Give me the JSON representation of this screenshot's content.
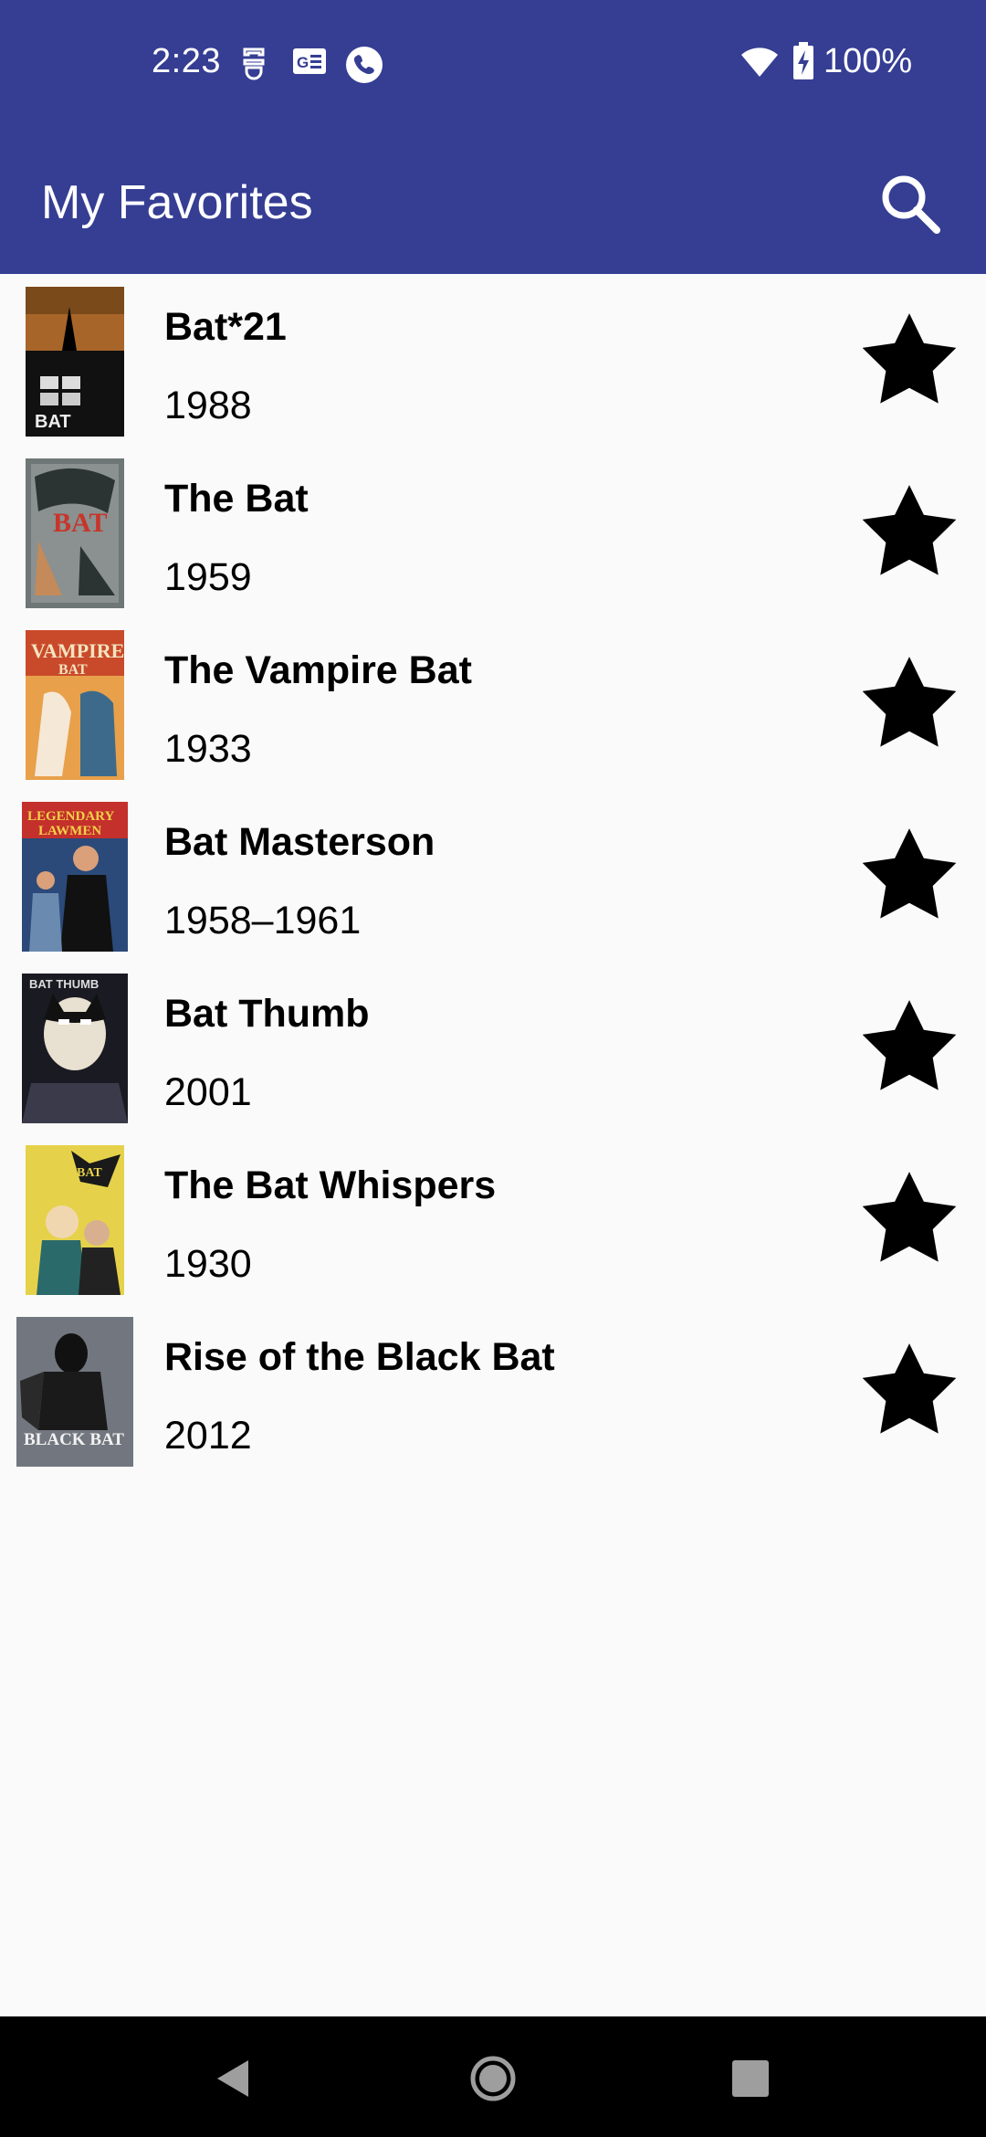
{
  "status_bar": {
    "time": "2:23",
    "battery": "100%",
    "icons": [
      "data-saver-icon",
      "news-icon",
      "phone-call-icon",
      "wifi-icon",
      "battery-charging-icon"
    ]
  },
  "app_bar": {
    "title": "My Favorites",
    "search_icon": "search-icon",
    "color": "#353e93"
  },
  "favorites": [
    {
      "title": "Bat*21",
      "year": "1988",
      "favorited": true
    },
    {
      "title": "The Bat",
      "year": "1959",
      "favorited": true
    },
    {
      "title": "The Vampire Bat",
      "year": "1933",
      "favorited": true
    },
    {
      "title": "Bat Masterson",
      "year": "1958–1961",
      "favorited": true
    },
    {
      "title": "Bat Thumb",
      "year": "2001",
      "favorited": true
    },
    {
      "title": "The Bat Whispers",
      "year": "1930",
      "favorited": true
    },
    {
      "title": "Rise of the Black Bat",
      "year": "2012",
      "favorited": true
    }
  ],
  "nav_bar": {
    "buttons": [
      "back-icon",
      "home-icon",
      "recents-icon"
    ]
  }
}
